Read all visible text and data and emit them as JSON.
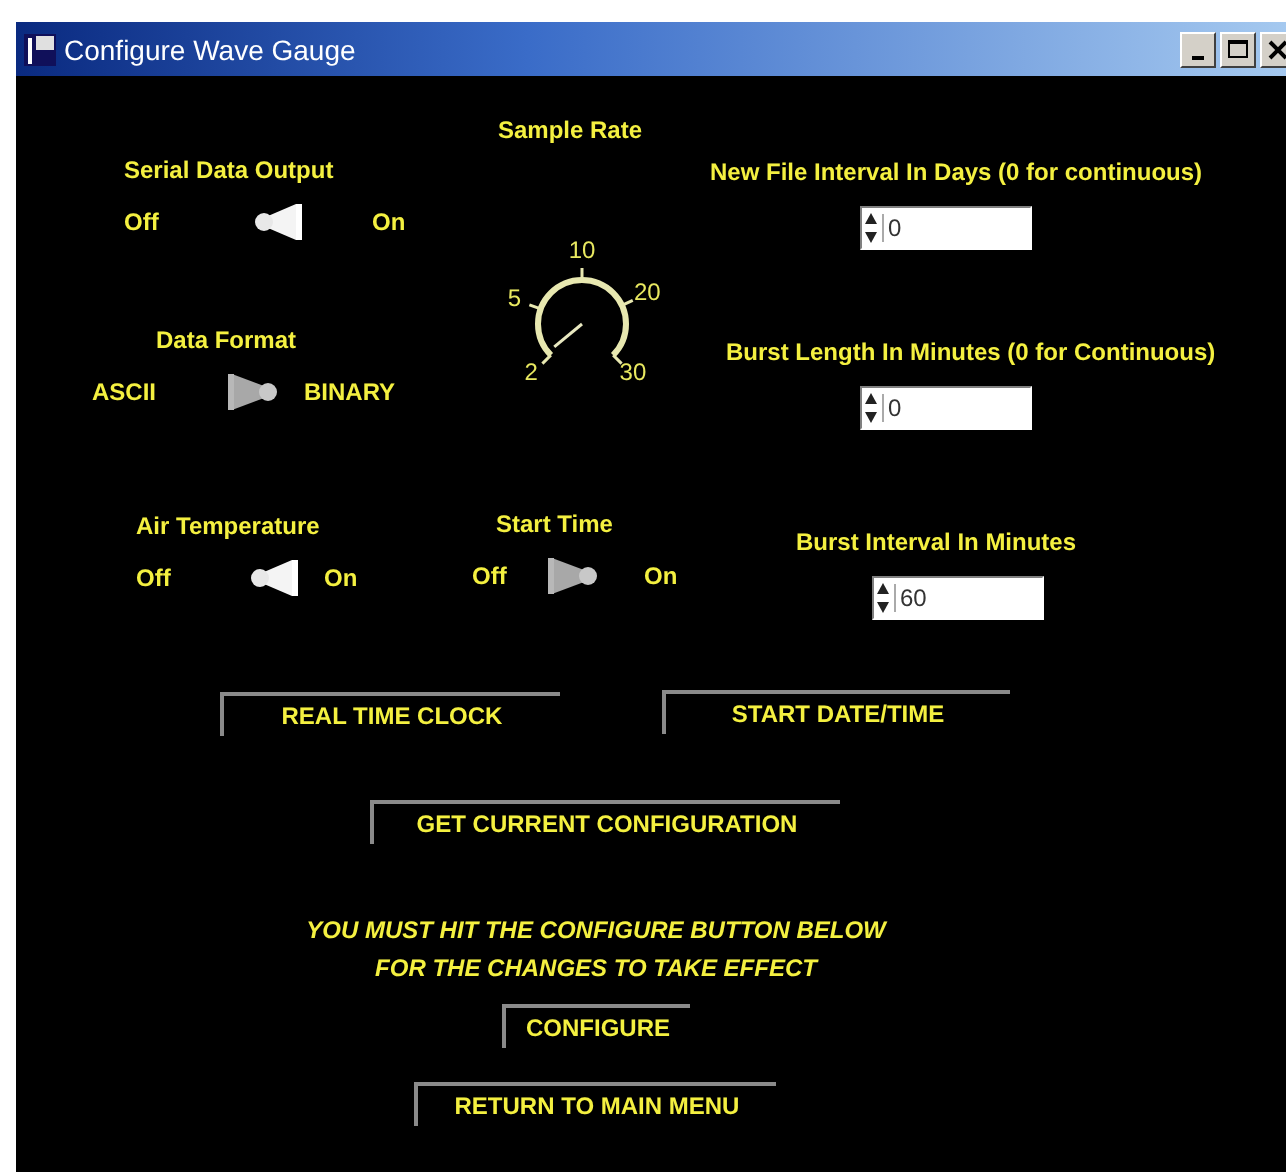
{
  "window": {
    "title": "Configure Wave Gauge"
  },
  "toggles": [
    {
      "label": "Serial Data Output",
      "off_label": "Off",
      "on_label": "On",
      "on": true
    },
    {
      "label": "Data Format",
      "off_label": "ASCII",
      "on_label": "BINARY",
      "on": false
    },
    {
      "label": "Air Temperature",
      "off_label": "Off",
      "on_label": "On",
      "on": true
    },
    {
      "label": "Start Time",
      "off_label": "Off",
      "on_label": "On",
      "on": false
    }
  ],
  "knob": {
    "label": "Sample Rate",
    "ticks": [
      "2",
      "5",
      "10",
      "20",
      "30"
    ],
    "level": 0.02
  },
  "fields": [
    {
      "label": "New File Interval In Days (0 for continuous)",
      "value": "0"
    },
    {
      "label": "Burst Length In Minutes (0 for Continuous)",
      "value": "0"
    },
    {
      "label": "Burst Interval In Minutes",
      "value": "60"
    }
  ],
  "buttons": [
    "REAL TIME CLOCK",
    "START DATE/TIME",
    "GET CURRENT CONFIGURATION"
  ],
  "notice": [
    "YOU MUST HIT THE CONFIGURE BUTTON BELOW",
    "FOR THE CHANGES TO TAKE EFFECT"
  ],
  "bottom_buttons": [
    "CONFIGURE",
    "RETURN TO MAIN MENU"
  ]
}
